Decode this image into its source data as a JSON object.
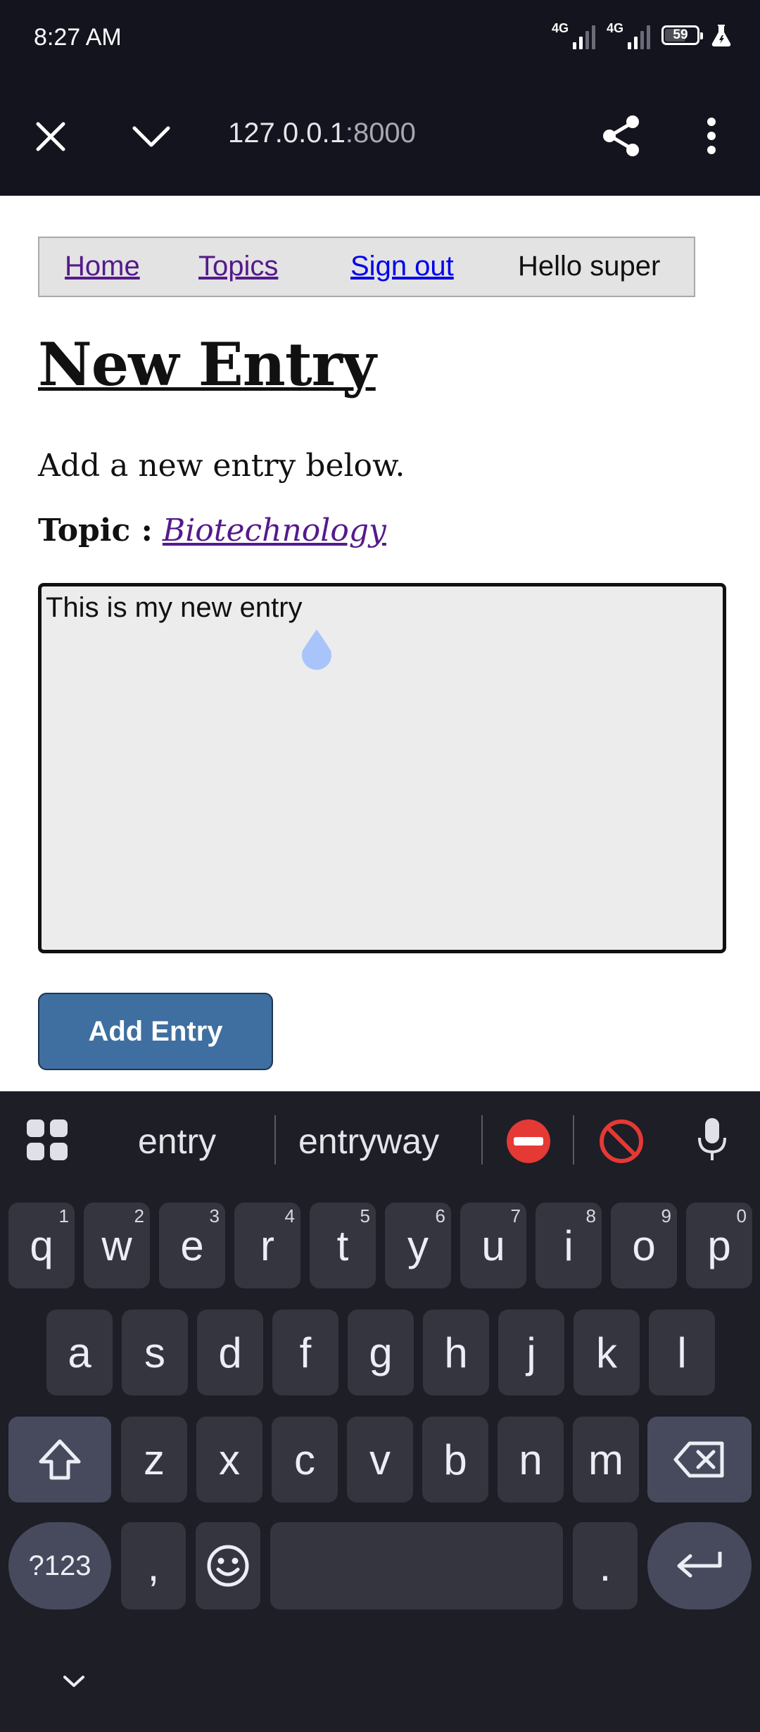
{
  "status": {
    "time": "8:27 AM",
    "network1": "4G",
    "network2": "4G",
    "battery": "59",
    "battery_level": 0.59
  },
  "browser": {
    "url_host": "127.0.0.1",
    "url_port": ":8000"
  },
  "nav": {
    "home": "Home",
    "topics": "Topics",
    "signout": "Sign out",
    "greeting": "Hello super"
  },
  "page": {
    "title": "New Entry",
    "subtitle": "Add a new entry below.",
    "topic_label": "Topic :",
    "topic_value": "Biotechnology",
    "entry_text": "This is my new entry",
    "submit_label": "Add Entry"
  },
  "keyboard": {
    "suggestions": [
      "entry",
      "entryway"
    ],
    "row1": [
      {
        "k": "q",
        "h": "1"
      },
      {
        "k": "w",
        "h": "2"
      },
      {
        "k": "e",
        "h": "3"
      },
      {
        "k": "r",
        "h": "4"
      },
      {
        "k": "t",
        "h": "5"
      },
      {
        "k": "y",
        "h": "6"
      },
      {
        "k": "u",
        "h": "7"
      },
      {
        "k": "i",
        "h": "8"
      },
      {
        "k": "o",
        "h": "9"
      },
      {
        "k": "p",
        "h": "0"
      }
    ],
    "row2": [
      "a",
      "s",
      "d",
      "f",
      "g",
      "h",
      "j",
      "k",
      "l"
    ],
    "row3": [
      "z",
      "x",
      "c",
      "v",
      "b",
      "n",
      "m"
    ],
    "symbols": "?123",
    "comma": ",",
    "period": "."
  }
}
